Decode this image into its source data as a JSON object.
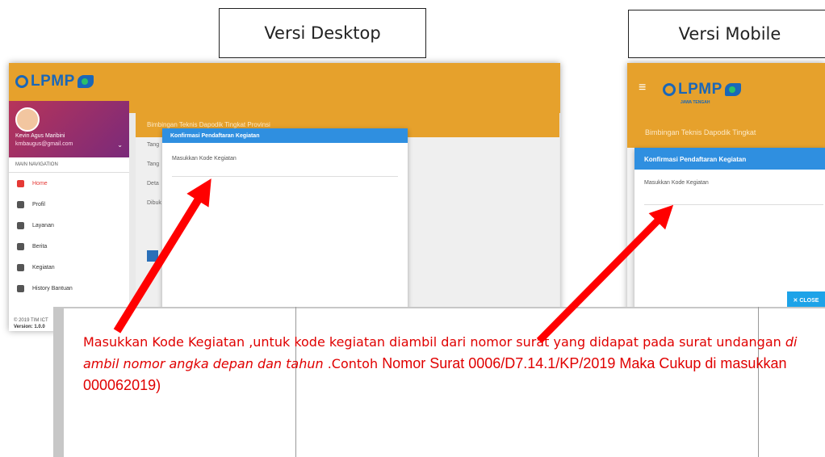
{
  "labels": {
    "desktop": "Versi Desktop",
    "mobile": "Versi Mobile"
  },
  "desktop": {
    "logo_text": "LPMP",
    "profile_name": "Kevin Agus Maribini",
    "profile_email": "kmbaugus@gmail.com",
    "nav_header": "MAIN NAVIGATION",
    "nav": [
      "Home",
      "Profil",
      "Layanan",
      "Berita",
      "Kegiatan",
      "History Bantuan"
    ],
    "footer": "© 2019 TIM ICT",
    "version": "Version: 1.0.0",
    "card_title": "Bimbingan Teknis Dapodik Tingkat Provinsi",
    "card_rows": [
      "Tang",
      "Tang",
      "Deta",
      "Dibuk"
    ]
  },
  "mobile": {
    "logo_text": "LPMP",
    "logo_sub": "JAWA TENGAH",
    "card_title": "Bimbingan Teknis Dapodik Tingkat"
  },
  "modal": {
    "title": "Konfirmasi Pendaftaran Kegiatan",
    "field_label": "Masukkan Kode Kegiatan",
    "close": "✕ CLOSE"
  },
  "note": {
    "p1": "Masukkan Kode Kegiatan ,untuk kode kegiatan diambil dari nomor surat yang didapat pada surat undangan ",
    "p1_italic": "di ambil nomor angka depan dan tahun",
    "p1_tail": " .Contoh ",
    "p2": "Nomor Surat 0006/D7.14.1/KP/2019  Maka Cukup di masukkan 000062019)"
  },
  "colors": {
    "header": "#e6a12c",
    "modal_header": "#2f8fe0",
    "close_button": "#1da3e8",
    "arrow": "#ff0000",
    "note_text": "#e00000"
  }
}
